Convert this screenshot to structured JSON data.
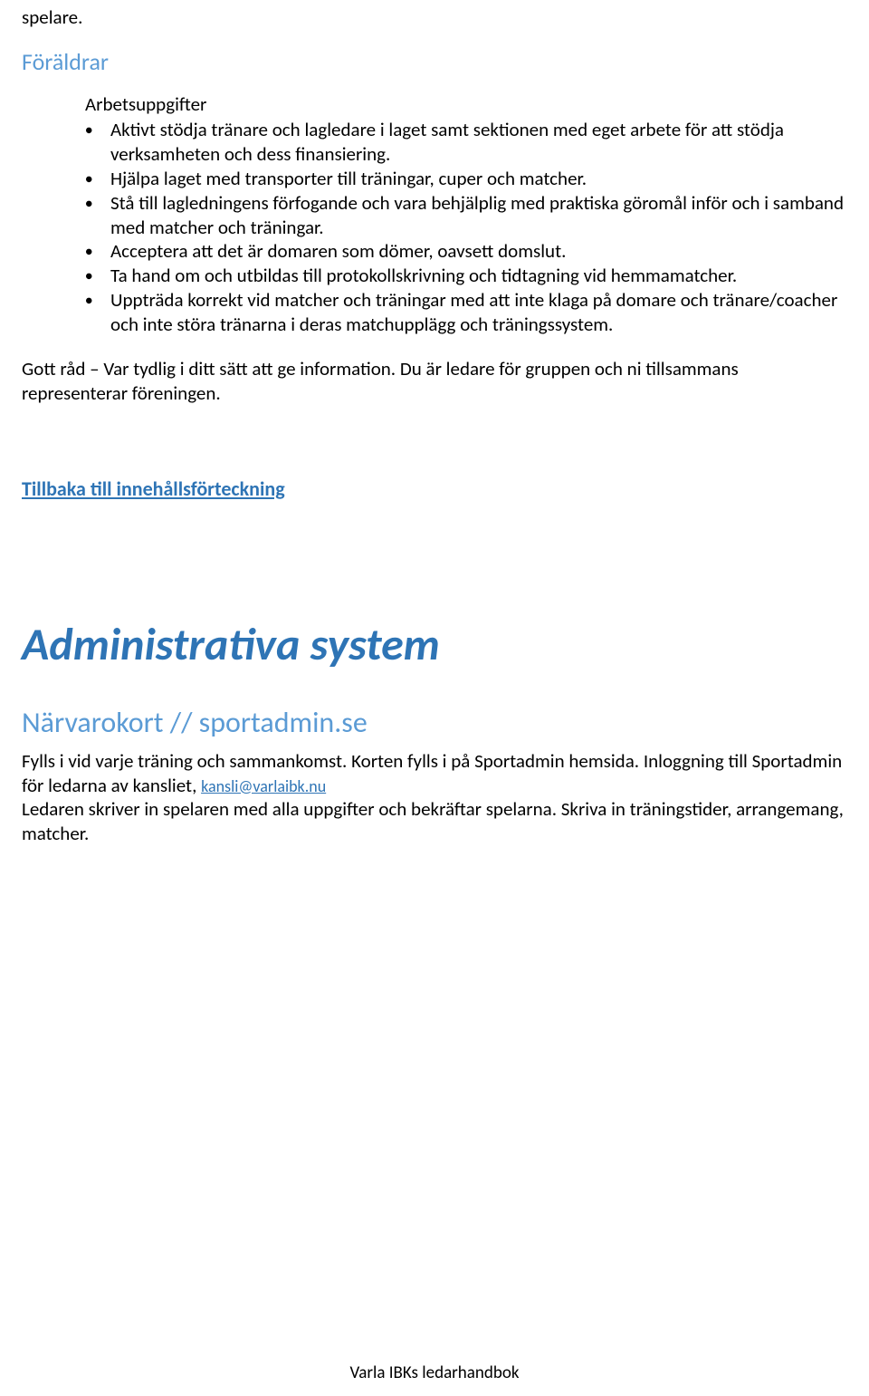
{
  "topWord": "spelare.",
  "sectionForaldrar": "Föräldrar",
  "arbetsuppgifter": "Arbetsuppgifter",
  "bullets": [
    "Aktivt stödja tränare och lagledare i laget samt sektionen med eget arbete för att stödja verksamheten och dess finansiering.",
    "Hjälpa laget med transporter till träningar, cuper och matcher.",
    "Stå till lagledningens förfogande och vara behjälplig med praktiska göromål inför och i samband med matcher och träningar.",
    "Acceptera att det är domaren som dömer, oavsett domslut.",
    "Ta hand om och utbildas till protokollskrivning och tidtagning vid hemmamatcher.",
    "Uppträda korrekt vid matcher och träningar med att inte klaga på domare och tränare/coacher och inte störa tränarna i deras matchupplägg och träningssystem."
  ],
  "gottRad": "Gott råd – Var tydlig i ditt sätt att ge information. Du är ledare för gruppen och ni tillsammans representerar föreningen.",
  "tocLink": "Tillbaka till innehållsförteckning",
  "h1": "Administrativa system",
  "h2": "Närvarokort // sportadmin.se",
  "para1a": "Fylls i vid varje träning och sammankomst. Korten fylls i på Sportadmin hemsida. Inloggning till Sportadmin för ledarna av kansliet, ",
  "emailLink": "kansli@varlaibk.nu",
  "para2": "Ledaren skriver in spelaren med alla uppgifter och bekräftar spelarna. Skriva in träningstider, arrangemang, matcher.",
  "footer": "Varla IBKs ledarhandbok"
}
